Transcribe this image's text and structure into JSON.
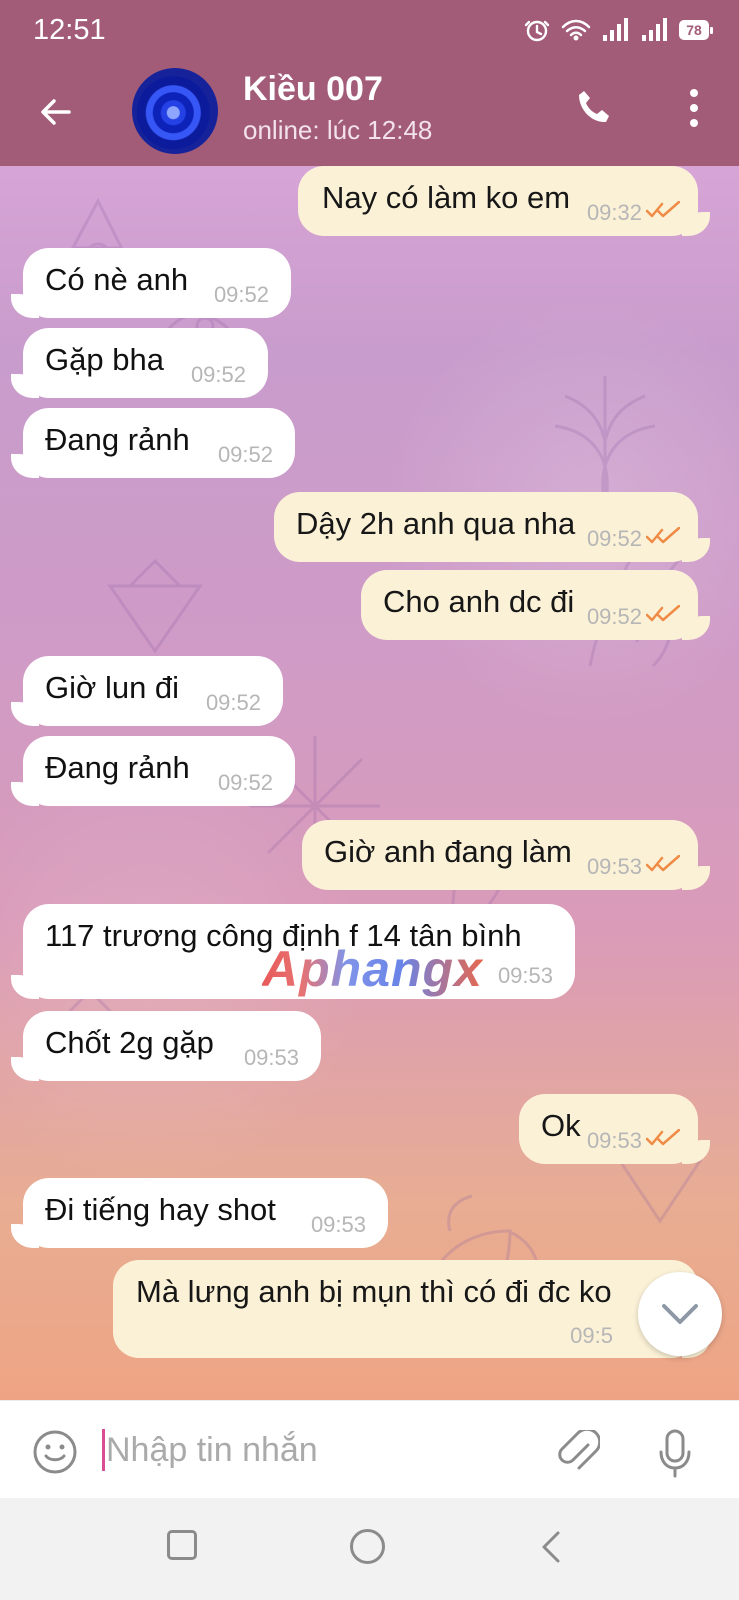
{
  "status_bar": {
    "time": "12:51",
    "battery": "78"
  },
  "header": {
    "contact_name": "Kiều 007",
    "contact_status": "online: lúc 12:48"
  },
  "messages": [
    {
      "id": "m1",
      "direction": "outgoing",
      "text": "Nay có làm ko em",
      "time": "09:32",
      "read": true
    },
    {
      "id": "m2",
      "direction": "incoming",
      "text": "Có nè anh",
      "time": "09:52"
    },
    {
      "id": "m3",
      "direction": "incoming",
      "text": "Gặp bha",
      "time": "09:52"
    },
    {
      "id": "m4",
      "direction": "incoming",
      "text": "Đang rảnh",
      "time": "09:52"
    },
    {
      "id": "m5",
      "direction": "outgoing",
      "text": "Dậy 2h anh qua nha",
      "time": "09:52",
      "read": true
    },
    {
      "id": "m6",
      "direction": "outgoing",
      "text": "Cho anh dc đi",
      "time": "09:52",
      "read": true
    },
    {
      "id": "m7",
      "direction": "incoming",
      "text": "Giờ lun đi",
      "time": "09:52"
    },
    {
      "id": "m8",
      "direction": "incoming",
      "text": "Đang rảnh",
      "time": "09:52"
    },
    {
      "id": "m9",
      "direction": "outgoing",
      "text": "Giờ anh đang làm",
      "time": "09:53",
      "read": true
    },
    {
      "id": "m10",
      "direction": "incoming",
      "text": "117 trương công định f 14 tân bình",
      "time": "09:53"
    },
    {
      "id": "m11",
      "direction": "incoming",
      "text": "Chốt 2g gặp",
      "time": "09:53"
    },
    {
      "id": "m12",
      "direction": "outgoing",
      "text": "Ok",
      "time": "09:53",
      "read": true
    },
    {
      "id": "m13",
      "direction": "incoming",
      "text": "Đi tiếng hay shot",
      "time": "09:53"
    },
    {
      "id": "m14",
      "direction": "outgoing",
      "text": "Mà lưng anh bị mụn thì có đi đc ko",
      "time": "09:5"
    }
  ],
  "watermark": "Aphangx",
  "composer": {
    "placeholder": "Nhập tin nhắn"
  },
  "icons": {
    "back": "arrow-left-icon",
    "call": "phone-icon",
    "more": "vertical-dots-icon",
    "emoji": "smile-icon",
    "attach": "paperclip-icon",
    "mic": "microphone-icon",
    "scroll": "chevron-down-icon"
  },
  "colors": {
    "header": "#a25c78",
    "incoming_bubble": "#ffffff",
    "outgoing_bubble": "#fbf1d7",
    "tick": "#f08b46"
  }
}
